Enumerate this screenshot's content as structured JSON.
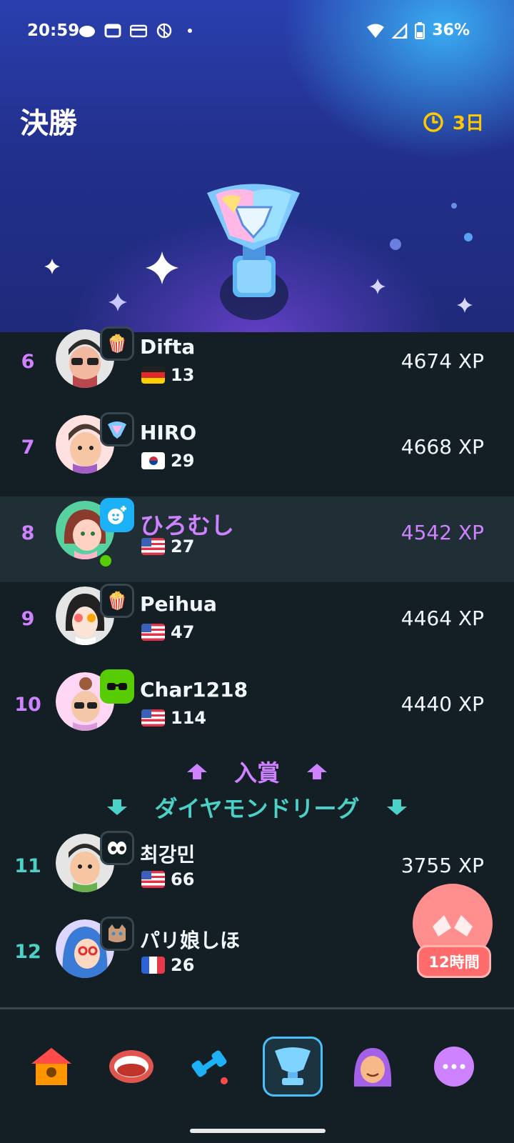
{
  "status_bar": {
    "time": "20:59",
    "battery": "36%"
  },
  "header": {
    "league_title": "決勝",
    "time_left": "3日"
  },
  "leaderboard": {
    "rows": [
      {
        "rank": "6",
        "name": "Difta",
        "flag": "germany",
        "streak": "13",
        "xp": "4674 XP",
        "badge_icon": "popcorn-icon"
      },
      {
        "rank": "7",
        "name": "HIRO",
        "flag": "south-korea",
        "streak": "29",
        "xp": "4668 XP",
        "badge_icon": "diamond-trophy-icon"
      },
      {
        "rank": "8",
        "name": "ひろむし",
        "flag": "usa",
        "streak": "27",
        "xp": "4542 XP",
        "badge_icon": "add-friend-icon",
        "is_current_user": true
      },
      {
        "rank": "9",
        "name": "Peihua",
        "flag": "usa",
        "streak": "47",
        "xp": "4464 XP",
        "badge_icon": "popcorn-icon"
      },
      {
        "rank": "10",
        "name": "Char1218",
        "flag": "usa",
        "streak": "114",
        "xp": "4440 XP",
        "badge_icon": "cool-owl-icon"
      },
      {
        "rank": "11",
        "name": "최강민",
        "flag": "usa",
        "streak": "66",
        "xp": "3755 XP",
        "badge_icon": "eyes-icon"
      },
      {
        "rank": "12",
        "name": "パリ娘しほ",
        "flag": "france",
        "streak": "26",
        "xp": "",
        "badge_icon": "cat-icon"
      }
    ],
    "promotion_label": "入賞",
    "demotion_label": "ダイヤモンドリーグ"
  },
  "chest": {
    "timer": "12時間"
  },
  "nav": {
    "items": [
      "home-icon",
      "speaking-icon",
      "practice-icon",
      "leaderboard-icon",
      "characters-icon",
      "more-icon"
    ],
    "active": "leaderboard-icon"
  },
  "colors": {
    "background": "#131f24",
    "promotion": "#ce82ff",
    "demotion": "#4bd1c7",
    "timer": "#ffc800",
    "current_user_row": "#202f36"
  }
}
